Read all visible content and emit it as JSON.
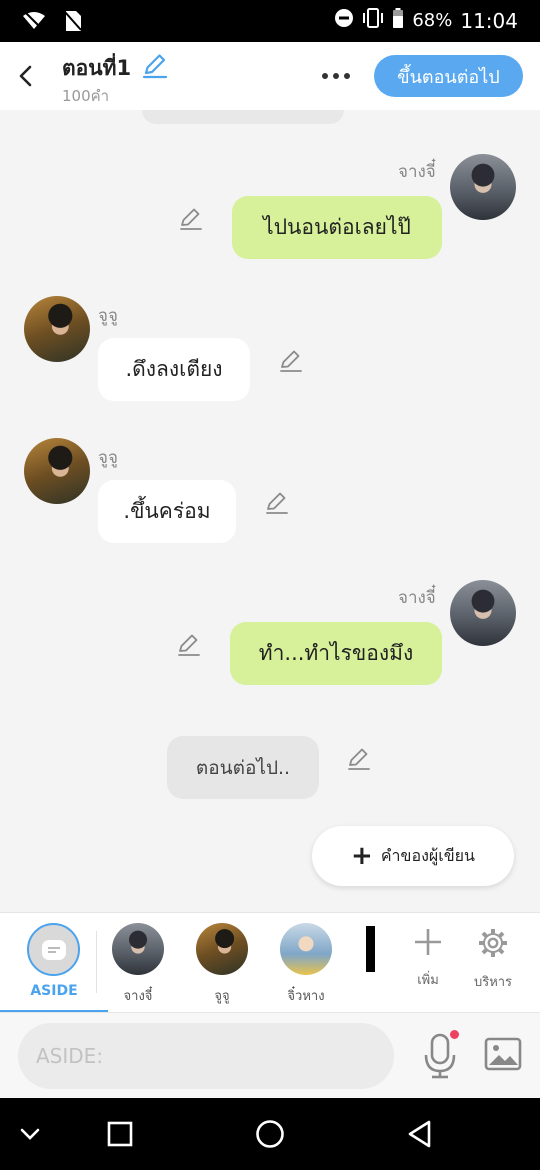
{
  "status_bar": {
    "battery": "68%",
    "time": "11:04"
  },
  "header": {
    "title": "ตอนที่1",
    "word_count": "100คำ",
    "next_button": "ขึ้นตอนต่อไป"
  },
  "messages": [
    {
      "sender": "จางจี๋",
      "text": "ไปนอนต่อเลยไป๊",
      "side": "right"
    },
    {
      "sender": "จูจู",
      "text": ".ดึงลงเตียง",
      "side": "left"
    },
    {
      "sender": "จูจู",
      "text": ".ขึ้นคร่อม",
      "side": "left"
    },
    {
      "sender": "จางจี๋",
      "text": "ทำ...ทำไรของมึง",
      "side": "right"
    }
  ],
  "aside_message": "ตอนต่อไป..",
  "author_button": "คำของผู้เขียน",
  "character_bar": {
    "aside_label": "ASIDE",
    "characters": [
      {
        "name": "จางจี๋"
      },
      {
        "name": "จูจู"
      },
      {
        "name": "จิ๋วหาง"
      }
    ],
    "add_label": "เพิ่ม",
    "manage_label": "บริหาร"
  },
  "input": {
    "placeholder": "ASIDE:"
  },
  "colors": {
    "accent": "#5aa9f0",
    "bubble_green": "#d7f09a",
    "aside_blue": "#4aa3ec"
  }
}
